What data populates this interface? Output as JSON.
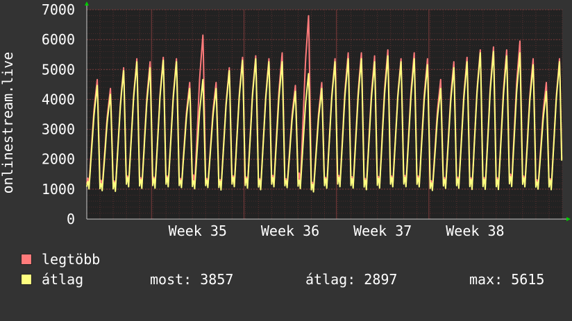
{
  "chart_data": {
    "type": "line",
    "ylabel": "onlinestream.live",
    "ylim": [
      0,
      7000
    ],
    "yticks": [
      0,
      1000,
      2000,
      3000,
      4000,
      5000,
      6000,
      7000
    ],
    "xtick_labels": [
      "Week 35",
      "Week 36",
      "Week 37",
      "Week 38"
    ],
    "grid": true,
    "legend_placement": "bottom-left",
    "colors": {
      "background": "#333333",
      "plot_bg": "#222222",
      "grid": "#5a3030",
      "legbott": "#ff7b7b",
      "atlag": "#ffff80"
    },
    "series": [
      {
        "name": "legtöbb",
        "color": "#ff7b7b",
        "daily_peaks": [
          4700,
          4400,
          5100,
          5400,
          5300,
          5450,
          5400,
          4600,
          6200,
          4600,
          5100,
          5450,
          5500,
          5400,
          5600,
          4500,
          6850,
          4600,
          5400,
          5600,
          5600,
          5500,
          5700,
          5400,
          5600,
          5400,
          4700,
          5300,
          5450,
          5700,
          5800,
          5700,
          6000,
          5400,
          4600,
          5400
        ],
        "daily_lows": [
          1000,
          950,
          850,
          1000,
          950,
          950,
          1000,
          1000,
          950,
          1000,
          900,
          1000,
          950,
          900,
          1000,
          1000,
          950,
          850,
          950,
          1000,
          950,
          900,
          950,
          1000,
          1000,
          1000,
          900,
          950,
          950,
          900,
          900,
          900,
          1000,
          1000,
          950,
          900
        ]
      },
      {
        "name": "átlag",
        "color": "#ffff80",
        "daily_peaks": [
          4500,
          4200,
          5000,
          5300,
          5100,
          5350,
          5300,
          4400,
          4700,
          4400,
          5000,
          5350,
          5400,
          5300,
          5300,
          4300,
          4900,
          4400,
          5300,
          5400,
          5400,
          5300,
          5500,
          5300,
          5400,
          5200,
          4400,
          5100,
          5300,
          5600,
          5650,
          5500,
          5600,
          5200,
          4300,
          5300
        ],
        "daily_lows": [
          900,
          850,
          800,
          950,
          900,
          900,
          950,
          950,
          900,
          950,
          850,
          950,
          900,
          850,
          950,
          950,
          900,
          800,
          900,
          950,
          900,
          850,
          900,
          950,
          950,
          950,
          850,
          900,
          900,
          850,
          850,
          850,
          950,
          950,
          900,
          850
        ]
      }
    ]
  },
  "legend": {
    "items": [
      {
        "label": "legtöbb",
        "color": "#ff7b7b"
      },
      {
        "label": "átlag",
        "color": "#ffff80"
      }
    ]
  },
  "stats": {
    "most": "most: 3857",
    "atlag": "átlag: 2897",
    "max": "max: 5615"
  }
}
